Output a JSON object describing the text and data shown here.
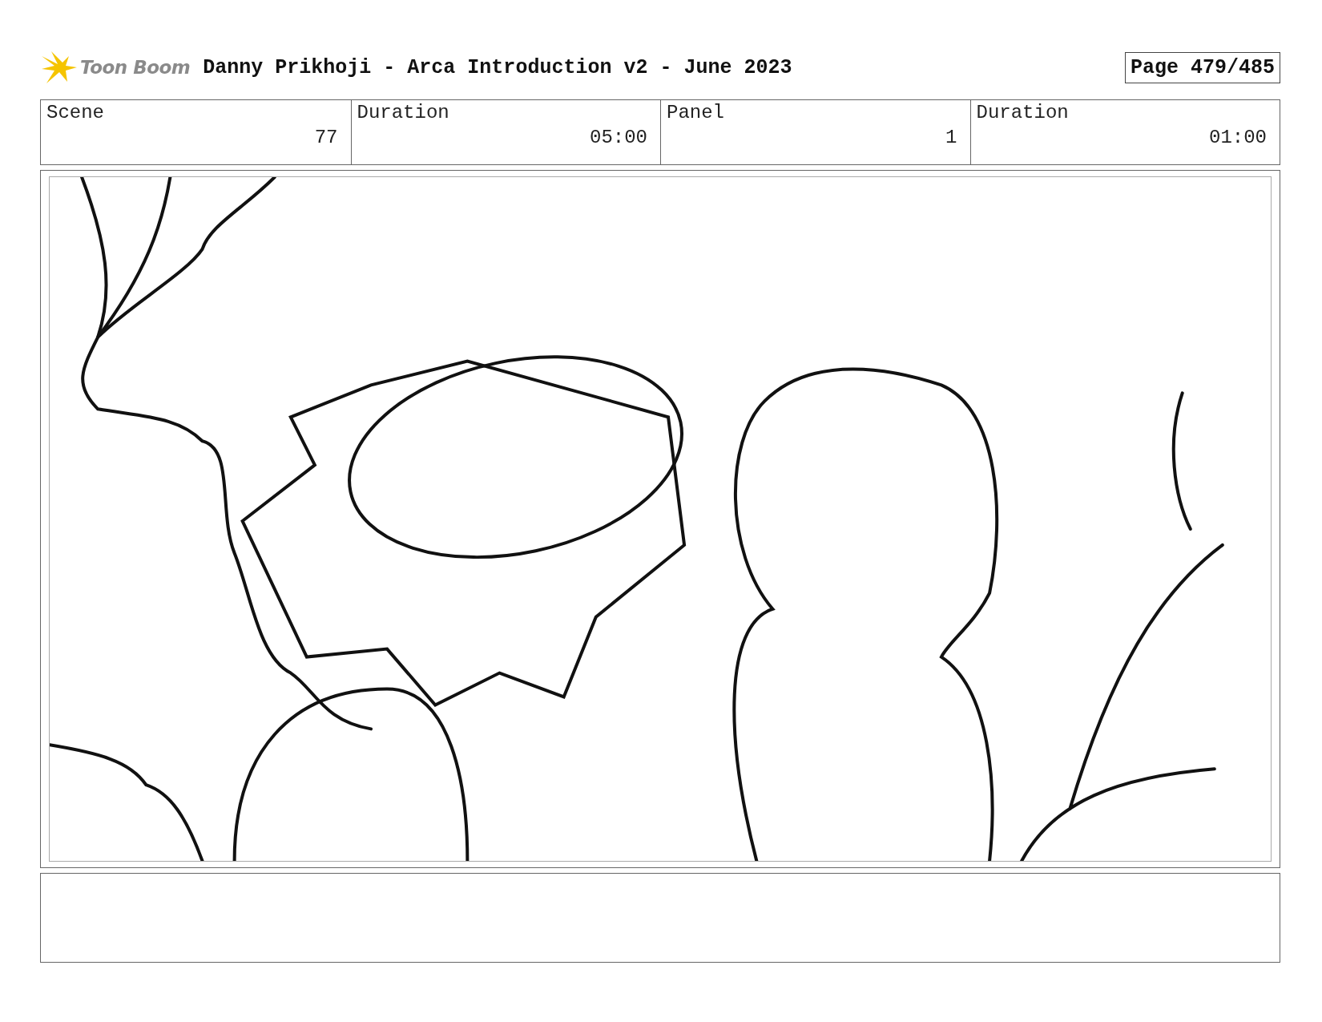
{
  "header": {
    "logo_text": "Toon Boom",
    "title": "Danny Prikhoji - Arca Introduction v2 - June 2023",
    "page": "Page 479/485"
  },
  "fields": [
    {
      "label": "Scene",
      "value": "77"
    },
    {
      "label": "Duration",
      "value": "05:00"
    },
    {
      "label": "Panel",
      "value": "1"
    },
    {
      "label": "Duration",
      "value": "01:00"
    }
  ]
}
